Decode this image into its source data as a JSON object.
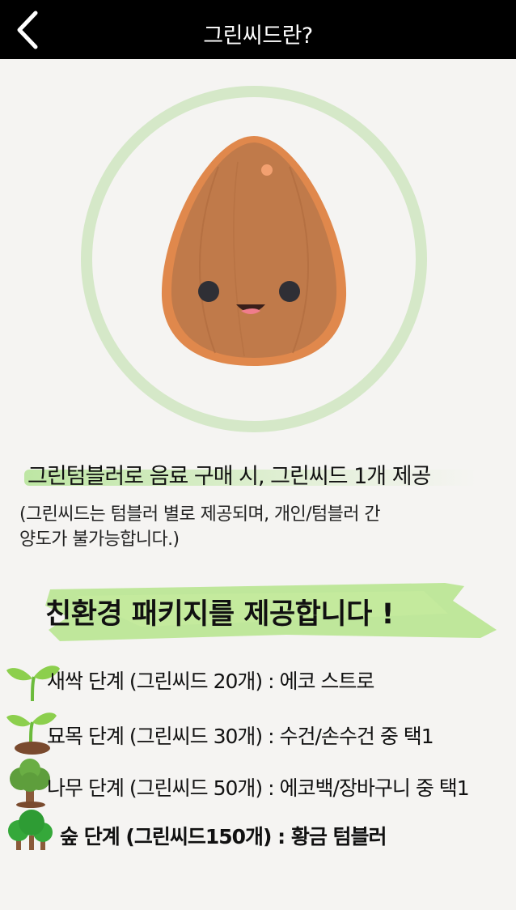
{
  "header": {
    "title": "그린씨드란?"
  },
  "colors": {
    "header_bg": "#000000",
    "ring": "#d5e8c8",
    "seed": "#c07a4a",
    "highlight": "#b5e48c"
  },
  "content": {
    "headline": "그린텀블러로 음료 구매 시, 그린씨드 1개 제공",
    "subtext_line1": "(그린씨드는 텀블러 별로 제공되며, 개인/텀블러 간",
    "subtext_line2": "양도가 불가능합니다.)",
    "package_title": "친환경 패키지를 제공합니다 !"
  },
  "tiers": [
    {
      "icon": "sprout-icon",
      "label": "새싹 단계 (그린씨드 20개) : 에코 스트로"
    },
    {
      "icon": "seedling-icon",
      "label": "묘목 단계 (그린씨드 30개) : 수건/손수건 중 택1"
    },
    {
      "icon": "tree-icon",
      "label": "나무 단계 (그린씨드 50개) : 에코백/장바구니 중 택1"
    },
    {
      "icon": "forest-icon",
      "label": "숲  단계 (그린씨드150개) : 황금 텀블러"
    }
  ]
}
